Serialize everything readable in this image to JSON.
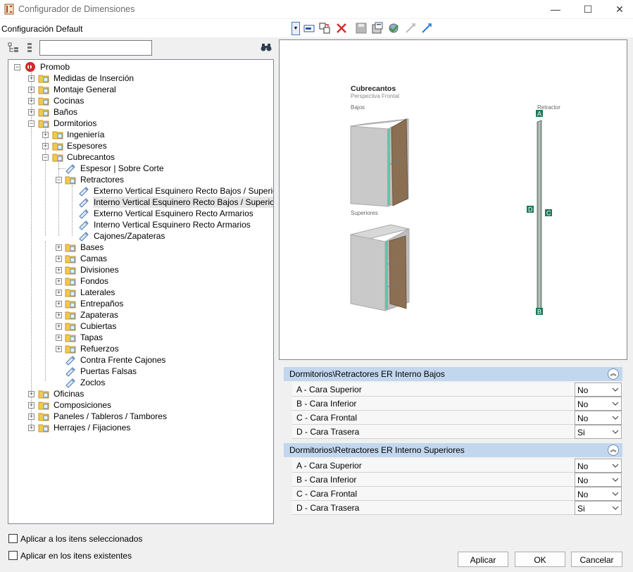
{
  "window": {
    "title": "Configurador de Dimensiones"
  },
  "config": {
    "label": "Configuración Default"
  },
  "toolbar": {
    "icons": [
      "dropdown-arrow",
      "edit-icon",
      "copy-icon",
      "delete-icon",
      "save-icon",
      "export-icon",
      "approve-icon",
      "collapse-link-icon",
      "expand-link-icon"
    ]
  },
  "search": {
    "value": "",
    "placeholder": ""
  },
  "tree": {
    "root": "Promob",
    "n1": "Medidas de Inserción",
    "n2": "Montaje General",
    "n3": "Cocinas",
    "n4": "Baños",
    "n5": "Dormitorios",
    "n6": "Ingeniería",
    "n7": "Espesores",
    "n8": "Cubrecantos",
    "n9": "Espesor | Sobre Corte",
    "n10": "Retractores",
    "n11": "Externo Vertical Esquinero Recto Bajos / Superiores",
    "n12": "Interno Vertical Esquinero Recto Bajos / Superiores",
    "n13": "Externo Vertical Esquinero Recto Armarios",
    "n14": "Interno Vertical Esquinero Recto Armarios",
    "n15": "Cajones/Zapateras",
    "n16": "Bases",
    "n17": "Camas",
    "n18": "Divisiones",
    "n19": "Fondos",
    "n20": "Laterales",
    "n21": "Entrepaños",
    "n22": "Zapateras",
    "n23": "Cubiertas",
    "n24": "Tapas",
    "n25": "Refuerzos",
    "n26": "Contra Frente Cajones",
    "n27": "Puertas Falsas",
    "n28": "Zoclos",
    "n29": "Oficinas",
    "n30": "Composiciones",
    "n31": "Paneles / Tableros / Tambores",
    "n32": "Herrajes / Fijaciones"
  },
  "preview": {
    "title": "Cubrecantos",
    "subtitle": "Perspectiva Frontal",
    "bajos": "Bajos",
    "superiores": "Superiores",
    "retractor": "Retractor",
    "tagA": "A",
    "tagB": "B",
    "tagC": "C",
    "tagD": "D"
  },
  "groups": [
    {
      "title": "Dormitorios\\Retractores ER Interno Bajos",
      "rows": [
        {
          "name": "A - Cara Superior",
          "value": "No"
        },
        {
          "name": "B - Cara Inferior",
          "value": "No"
        },
        {
          "name": "C - Cara Frontal",
          "value": "No"
        },
        {
          "name": "D - Cara Trasera",
          "value": "Si"
        }
      ]
    },
    {
      "title": "Dormitorios\\Retractores ER Interno Superiores",
      "rows": [
        {
          "name": "A - Cara Superior",
          "value": "No"
        },
        {
          "name": "B - Cara Inferior",
          "value": "No"
        },
        {
          "name": "C - Cara Frontal",
          "value": "No"
        },
        {
          "name": "D - Cara Trasera",
          "value": "Si"
        }
      ]
    }
  ],
  "options": {
    "apply_selected": "Aplicar a los itens seleccionados",
    "apply_existing": "Aplicar en los itens existentes"
  },
  "buttons": {
    "apply": "Aplicar",
    "ok": "OK",
    "cancel": "Cancelar"
  },
  "colors": {
    "accent_header": "#c2d7ee",
    "edge_green": "#1f7a5a",
    "wood": "#8b6f52"
  }
}
